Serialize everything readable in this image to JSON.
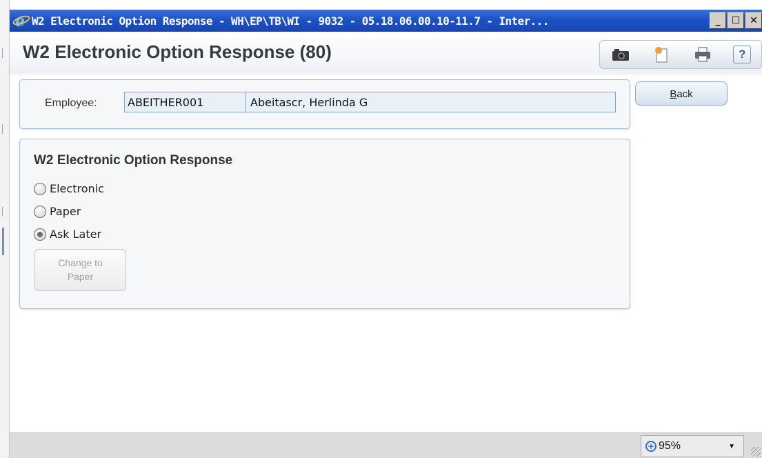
{
  "window": {
    "title": "W2 Electronic Option Response - WH\\EP\\TB\\WI - 9032 - 05.18.06.00.10-11.7 - Inter...",
    "buttons": {
      "minimize": "_",
      "maximize": "☐",
      "close": "✕"
    }
  },
  "header": {
    "title": "W2 Electronic Option Response (80)",
    "tools": [
      "camera-icon",
      "document-star-icon",
      "printer-icon",
      "help-icon"
    ],
    "help_label": "?"
  },
  "employee": {
    "label": "Employee:",
    "code": "ABEITHER001",
    "name": "Abeitascr, Herlinda G"
  },
  "back_button": {
    "accel": "B",
    "rest": "ack"
  },
  "option_panel": {
    "title": "W2 Electronic Option Response",
    "options": [
      {
        "label": "Electronic",
        "selected": false
      },
      {
        "label": "Paper",
        "selected": false
      },
      {
        "label": "Ask Later",
        "selected": true
      }
    ],
    "change_button": {
      "line1": "Change to",
      "line2": "Paper",
      "disabled": true
    }
  },
  "statusbar": {
    "zoom": "95%"
  },
  "colors": {
    "titlebar": "#1d52c4",
    "panel_border": "#a9bdd6",
    "disabled_text": "#a0a0a0"
  }
}
